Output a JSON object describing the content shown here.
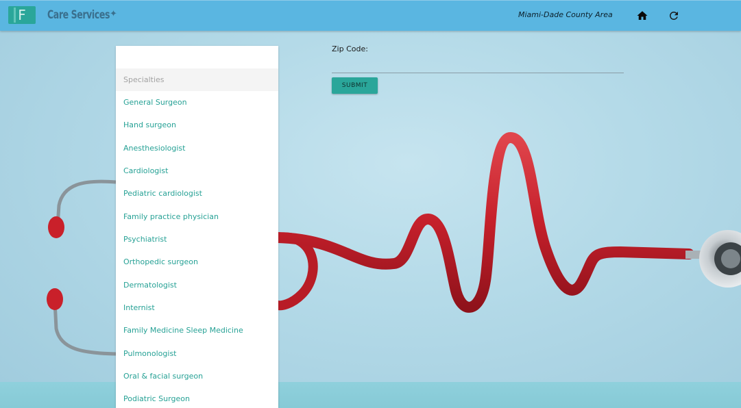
{
  "header": {
    "logo_letter": "F",
    "brand": "Care Services",
    "brand_sparkle": "✦",
    "area": "Miami-Dade County Area",
    "home_icon": "home-icon",
    "refresh_icon": "refresh-icon"
  },
  "specialties": {
    "header": "Specialties",
    "items": [
      "General Surgeon",
      "Hand surgeon",
      "Anesthesiologist",
      "Cardiologist",
      "Pediatric cardiologist",
      "Family practice physician",
      "Psychiatrist",
      "Orthopedic surgeon",
      "Dermatologist",
      "Internist",
      "Family Medicine Sleep Medicine",
      "Pulmonologist",
      "Oral & facial surgeon",
      "Podiatric Surgeon"
    ]
  },
  "zip_form": {
    "label": "Zip Code:",
    "value": "",
    "submit_label": "SUBMIT"
  },
  "colors": {
    "header_bg": "#5ab6e1",
    "accent": "#2aa69a",
    "link": "#26a195",
    "tube_red": "#c5202b"
  }
}
